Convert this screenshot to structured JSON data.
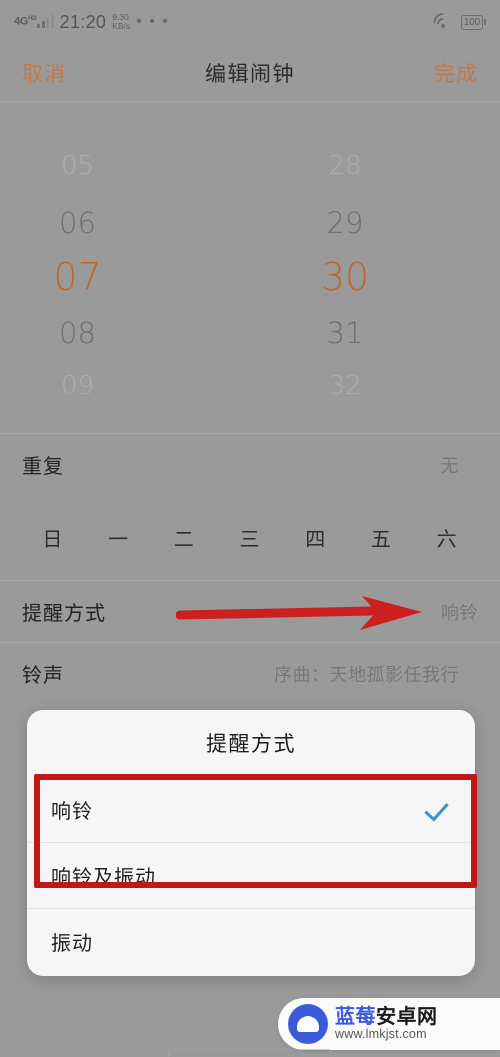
{
  "status_bar": {
    "network_type": "4G",
    "network_sup": "HD",
    "clock": "21:20",
    "speed_value": "9.30",
    "speed_unit": "KB/s",
    "overflow_dots": "• • •",
    "wifi_icon": "wifi-icon",
    "battery_level": "100"
  },
  "header": {
    "cancel_label": "取消",
    "title": "编辑闹钟",
    "done_label": "完成",
    "accent_color": "#c2794a"
  },
  "time_picker": {
    "hours": [
      "05",
      "06",
      "07",
      "08",
      "09"
    ],
    "minutes": [
      "28",
      "29",
      "30",
      "31",
      "32"
    ],
    "selected_hour": "07",
    "selected_minute": "30",
    "selected_color": "#c1662a"
  },
  "rows": {
    "repeat": {
      "label": "重复",
      "value": "无",
      "chevron": "chevron-right-icon"
    },
    "alert": {
      "label": "提醒方式",
      "value": "响铃"
    },
    "ringtone": {
      "label": "铃声",
      "value": "序曲：天地孤影任我行",
      "chevron": "chevron-right-icon"
    }
  },
  "weekdays": [
    "日",
    "一",
    "二",
    "三",
    "四",
    "五",
    "六"
  ],
  "annotation": {
    "arrow_color": "#cc2020",
    "highlight_color": "#c2171a"
  },
  "dialog": {
    "title": "提醒方式",
    "options": [
      {
        "label": "响铃",
        "selected": true
      },
      {
        "label": "响铃及振动",
        "selected": false
      },
      {
        "label": "振动",
        "selected": false
      }
    ],
    "check_color": "#3d8ec9"
  },
  "watermark": {
    "name_blue": "蓝莓",
    "name_dark": "安卓网",
    "url": "www.lmkjst.com",
    "logo_color": "#3b5bdb"
  }
}
